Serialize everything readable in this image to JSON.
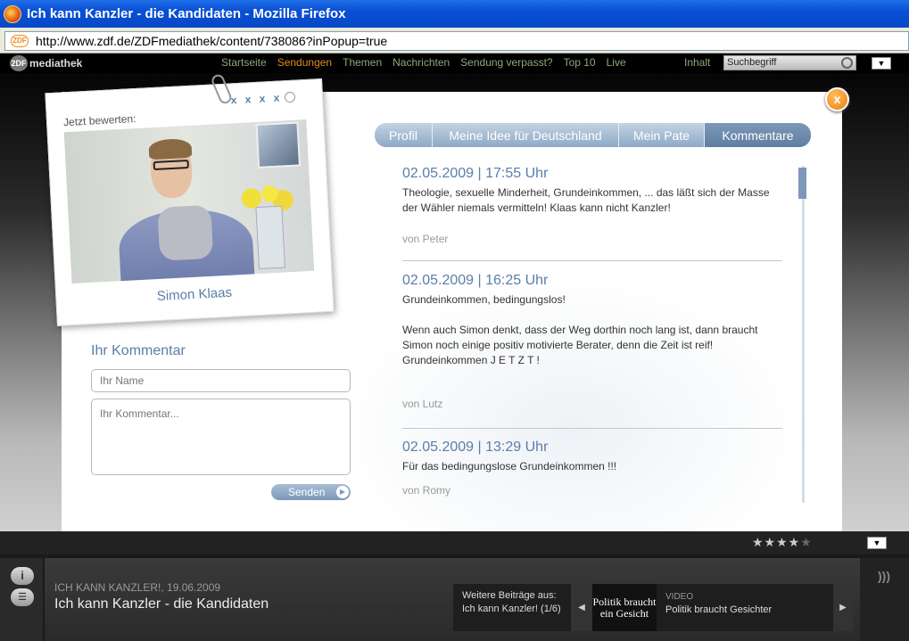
{
  "window": {
    "title": "Ich kann Kanzler - die Kandidaten - Mozilla Firefox",
    "url": "http://www.zdf.de/ZDFmediathek/content/738086?inPopup=true",
    "url_icon_label": "ZDF"
  },
  "nav": {
    "logo_mark": "2DF",
    "logo": "mediathek",
    "links": [
      "Startseite",
      "Sendungen",
      "Themen",
      "Nachrichten",
      "Sendung verpasst?",
      "Top 10",
      "Live"
    ],
    "active_link": "Sendungen",
    "inhalt": "Inhalt",
    "search_placeholder": "Suchbegriff",
    "dropdown": "▼"
  },
  "popup": {
    "close": "x",
    "rate_label": "Jetzt bewerten:",
    "rating_icons": [
      "x",
      "x",
      "x",
      "x"
    ],
    "candidate_name": "Simon Klaas",
    "comment_title": "Ihr Kommentar",
    "name_placeholder": "Ihr Name",
    "comment_placeholder": "Ihr Kommentar...",
    "send_label": "Senden",
    "send_arrow": "▶",
    "tabs": [
      "Profil",
      "Meine Idee für Deutschland",
      "Mein Pate",
      "Kommentare"
    ],
    "active_tab": "Kommentare",
    "comments": [
      {
        "date": "02.05.2009 | 17:55 Uhr",
        "text": "Theologie, sexuelle Minderheit, Grundeinkommen, ... das läßt sich der Masse der Wähler niemals vermitteln! Klaas kann nicht Kanzler!",
        "author": "von Peter"
      },
      {
        "date": "02.05.2009 | 16:25 Uhr",
        "text": "Grundeinkommen, bedingungslos!\n\nWenn auch Simon denkt, dass der Weg dorthin noch lang ist, dann braucht Simon noch einige positiv motivierte Berater, denn die Zeit ist reif! Grundeinkommen J E T Z T !",
        "author": "von Lutz"
      },
      {
        "date": "02.05.2009 | 13:29 Uhr",
        "text": "Für das bedingungslose Grundeinkommen !!!",
        "author": "von Romy"
      }
    ]
  },
  "bottom": {
    "stars_filled": "★★★★",
    "stars_empty": "★",
    "dropdown": "▼",
    "info_icon": "i",
    "list_icon": "☰",
    "meta": "ICH KANN KANZLER!,  19.06.2009",
    "title": "Ich kann Kanzler - die Kandidaten",
    "more_label": "Weitere Beiträge aus:",
    "more_value": "Ich kann Kanzler!  (1/6)",
    "prev": "◀",
    "thumb_text": "Politik braucht ein Gesicht",
    "video_label": "VIDEO",
    "video_title": "Politik braucht Gesichter",
    "next": "▶",
    "rss": ")))"
  }
}
